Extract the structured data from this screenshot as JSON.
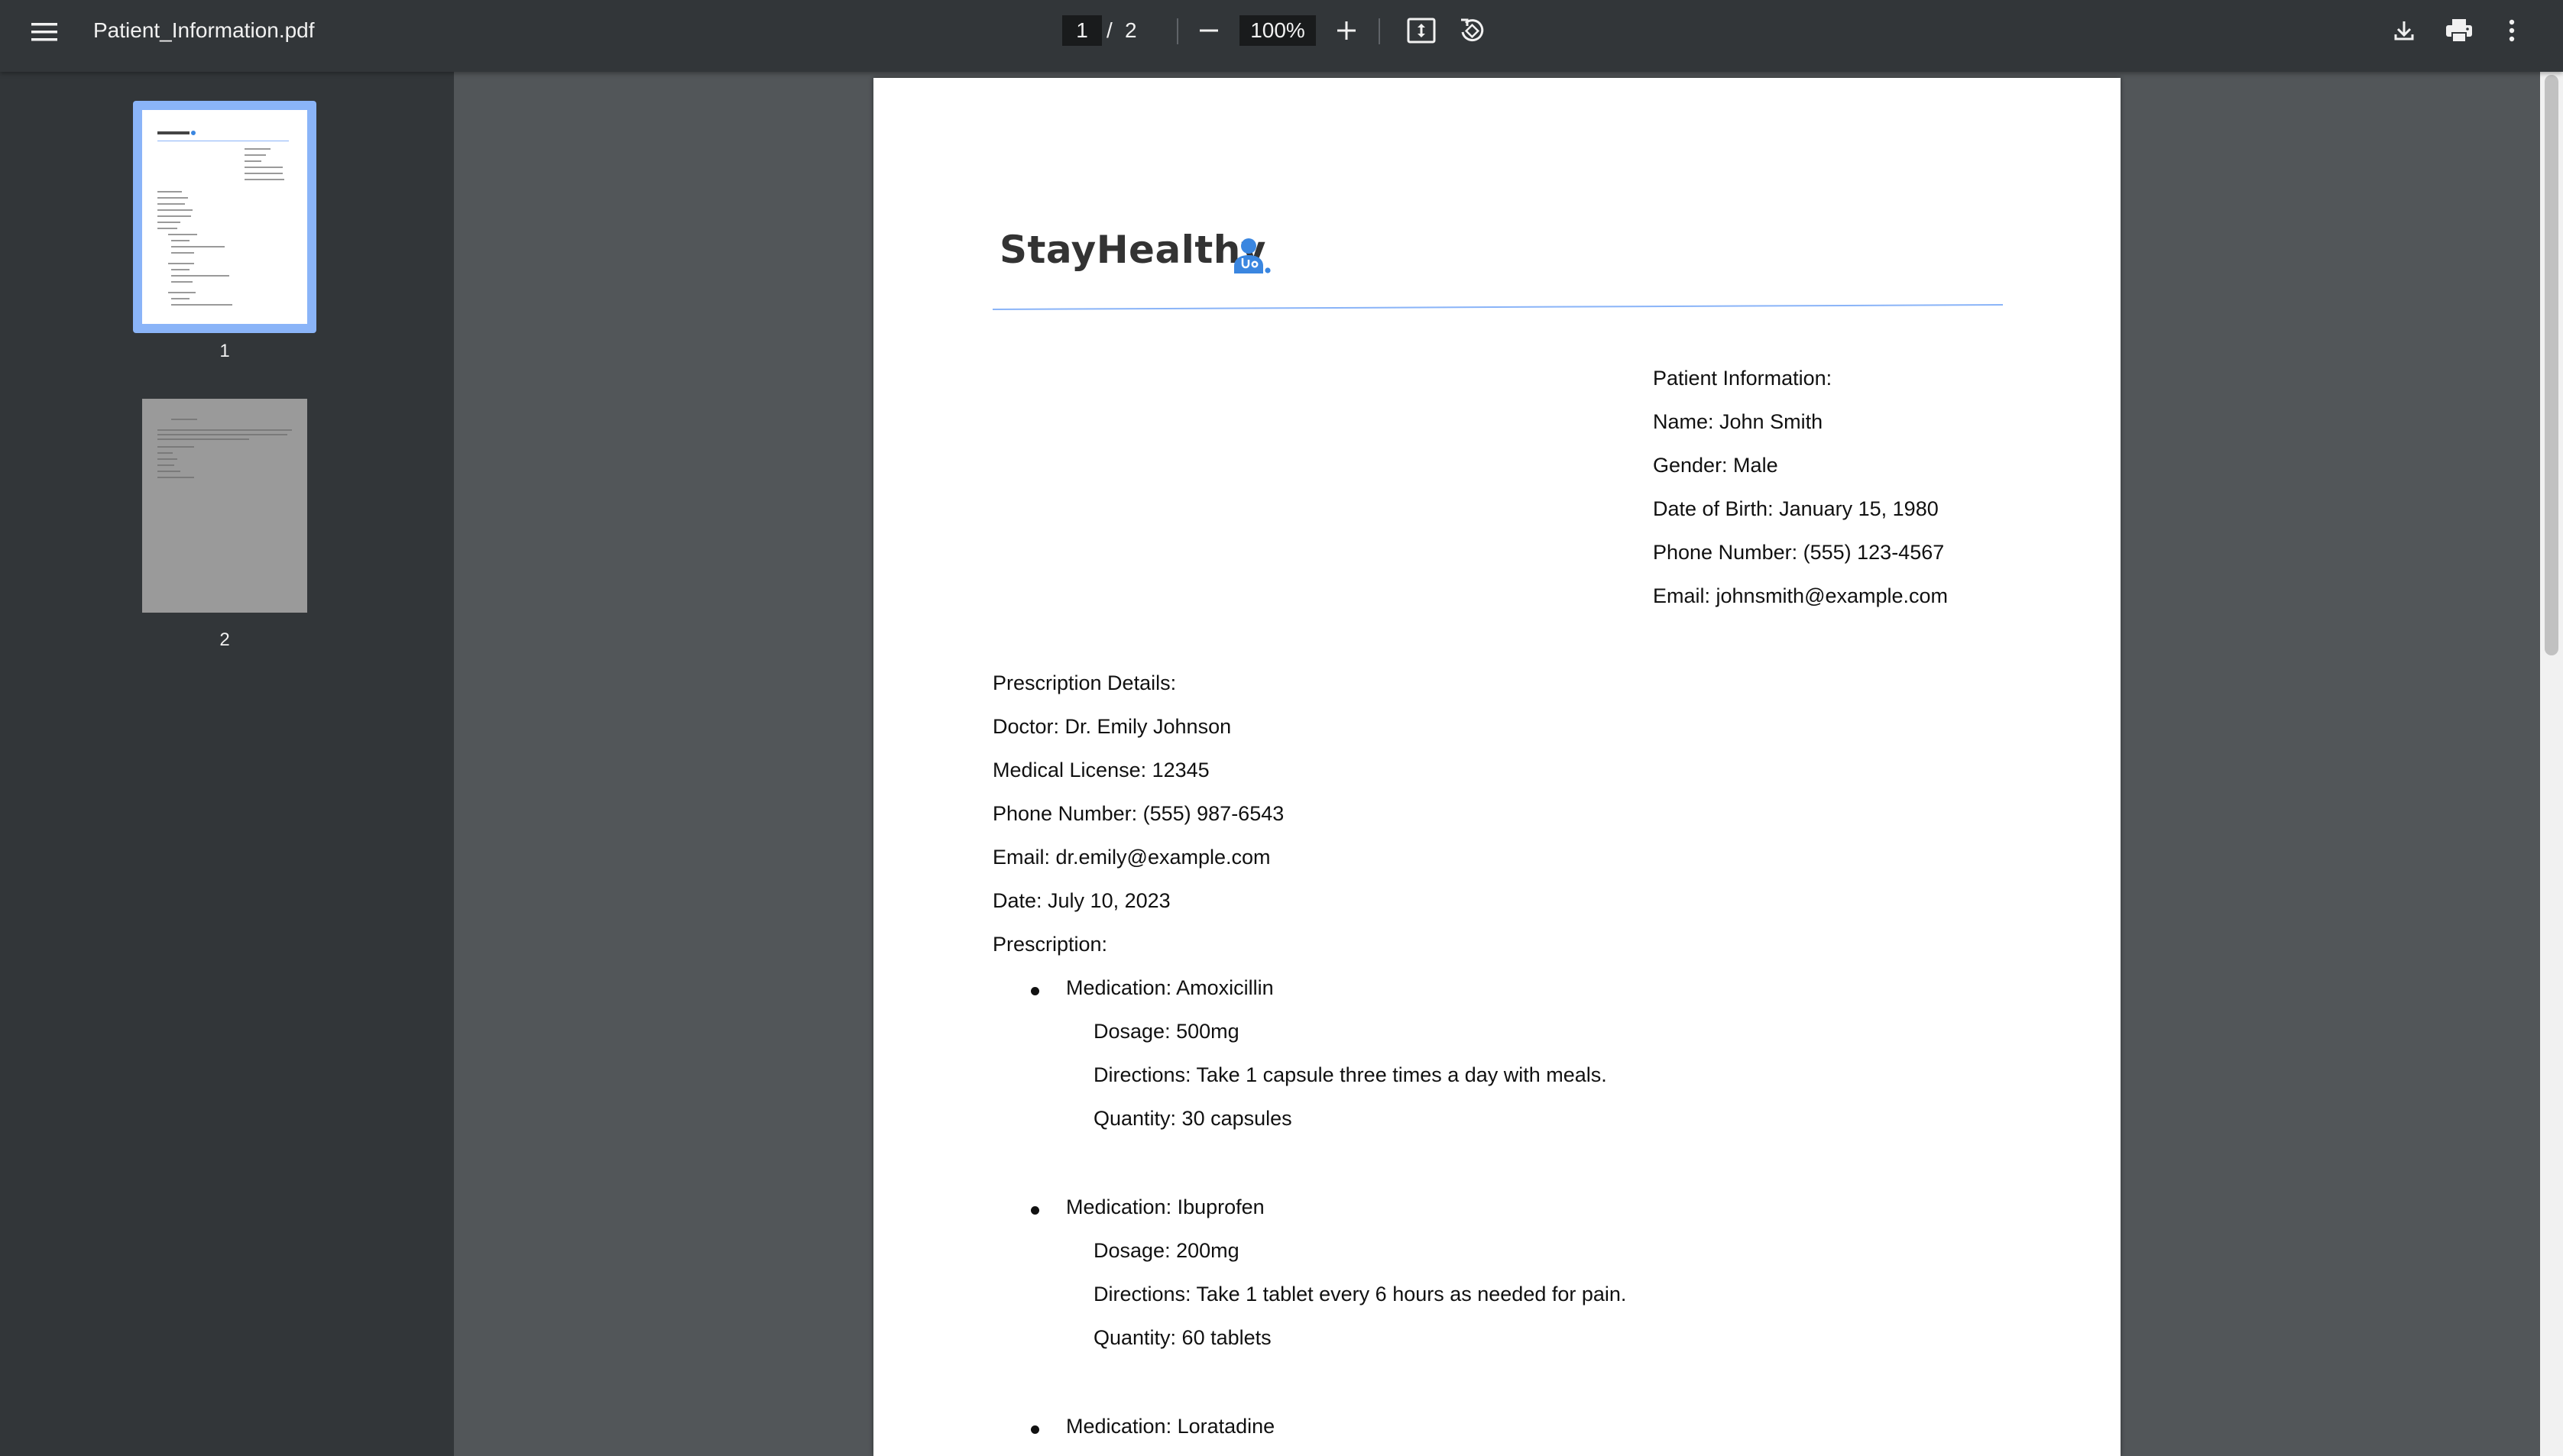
{
  "toolbar": {
    "menu_icon": "hamburger-menu-icon",
    "title": "Patient_Information.pdf",
    "current_page": "1",
    "page_separator": "/",
    "total_pages": "2",
    "zoom_out_icon": "minus-icon",
    "zoom": "100%",
    "zoom_in_icon": "plus-icon",
    "fit_icon": "fit-to-page-icon",
    "rotate_icon": "rotate-icon",
    "download_icon": "download-icon",
    "print_icon": "print-icon",
    "more_icon": "more-vert-icon"
  },
  "sidebar": {
    "thumbnails": [
      {
        "label": "1",
        "selected": true
      },
      {
        "label": "2",
        "selected": false
      }
    ],
    "selection_color": "#8ab4f8"
  },
  "document": {
    "logo_text": "StayHealthy",
    "logo_icon": "doctor-icon",
    "brand_color": "#3a86e0",
    "patient": {
      "heading": "Patient Information:",
      "name": "Name: John Smith",
      "gender": "Gender: Male",
      "dob": "Date of Birth: January 15, 1980",
      "phone": "Phone Number: (555) 123-4567",
      "email": "Email: johnsmith@example.com"
    },
    "prescription": {
      "heading": "Prescription Details:",
      "doctor": "Doctor: Dr. Emily Johnson",
      "license": "Medical License: 12345",
      "phone": "Phone Number: (555) 987-6543",
      "email": "Email: dr.emily@example.com",
      "date": "Date: July 10, 2023",
      "label": "Prescription:",
      "medications": [
        {
          "name": "Medication: Amoxicillin",
          "dosage": "Dosage: 500mg",
          "directions": "Directions: Take 1 capsule three times a day with meals.",
          "quantity": "Quantity: 30 capsules"
        },
        {
          "name": "Medication: Ibuprofen",
          "dosage": "Dosage: 200mg",
          "directions": "Directions: Take 1 tablet every 6 hours as needed for pain.",
          "quantity": "Quantity: 60 tablets"
        },
        {
          "name": "Medication: Loratadine"
        }
      ]
    }
  }
}
